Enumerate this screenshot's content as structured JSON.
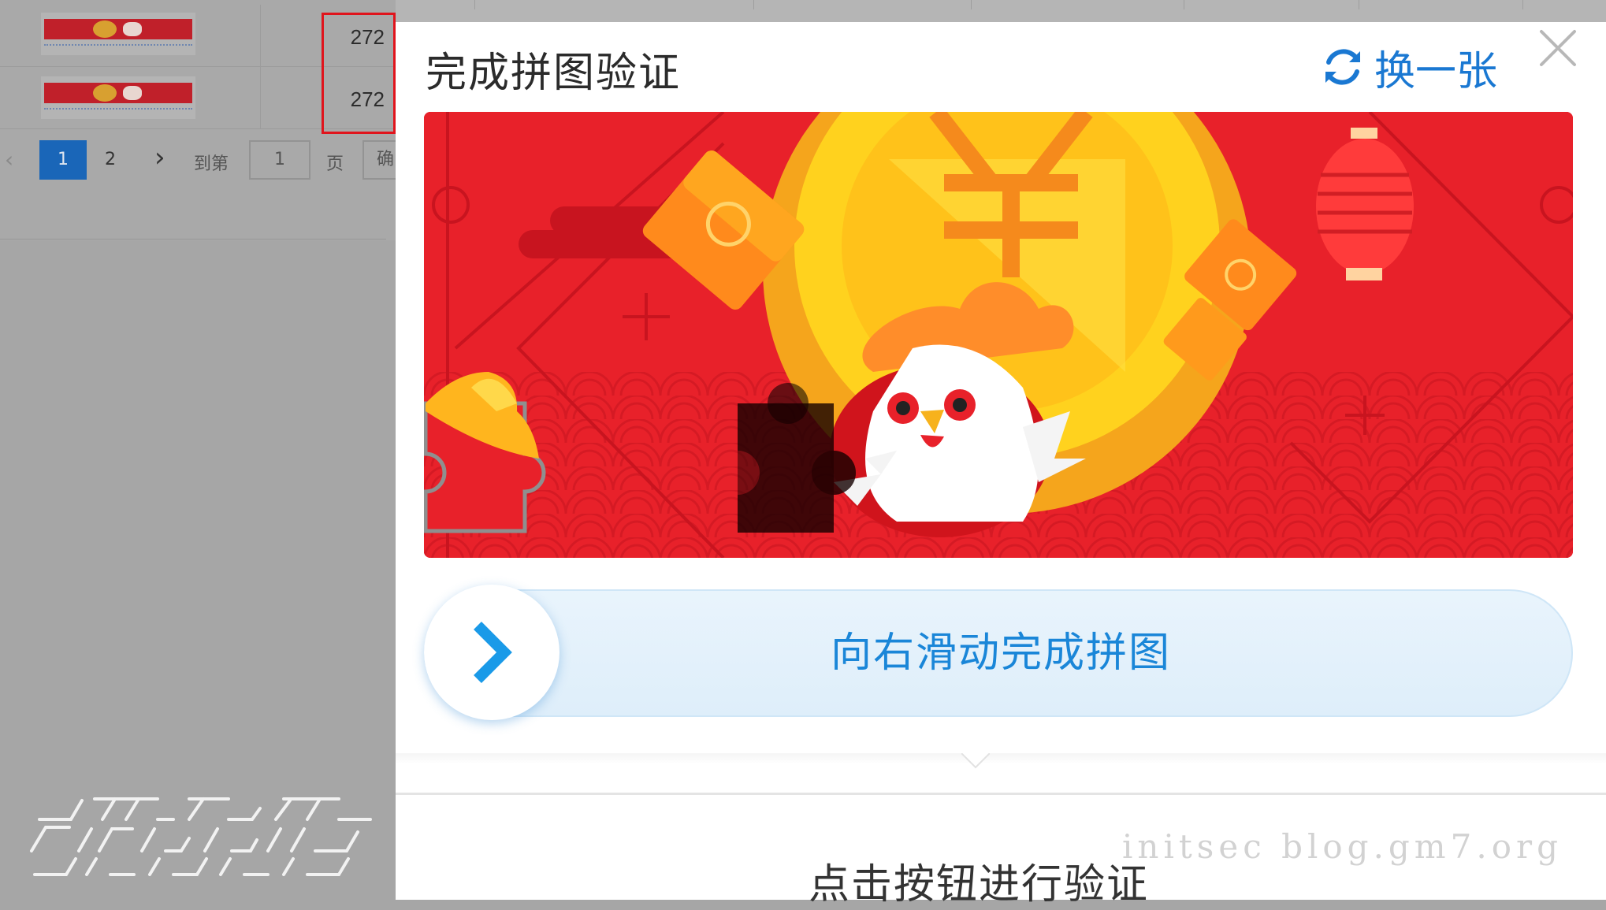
{
  "table": {
    "rows": [
      {
        "value": "272"
      },
      {
        "value": "272"
      }
    ]
  },
  "pagination": {
    "prev_icon": "chevron-left-icon",
    "pages": [
      "1",
      "2"
    ],
    "active_page": "1",
    "next_icon": "chevron-right-icon",
    "goto_label": "到第",
    "goto_value": "1",
    "page_label": "页",
    "confirm_label": "确"
  },
  "captcha": {
    "title": "完成拼图验证",
    "refresh_icon": "refresh-icon",
    "refresh_label": "换一张",
    "close_icon": "close-icon",
    "slider_label": "向右滑动完成拼图",
    "slider_icon": "chevron-right-icon",
    "verify_button": "点击按钮进行验证"
  },
  "colors": {
    "accent": "#1a78d2",
    "highlight_border": "#e0141c",
    "active_page": "#1a66b8",
    "puzzle_bg": "#e8212a"
  },
  "watermark": "initsec blog.gm7.org"
}
